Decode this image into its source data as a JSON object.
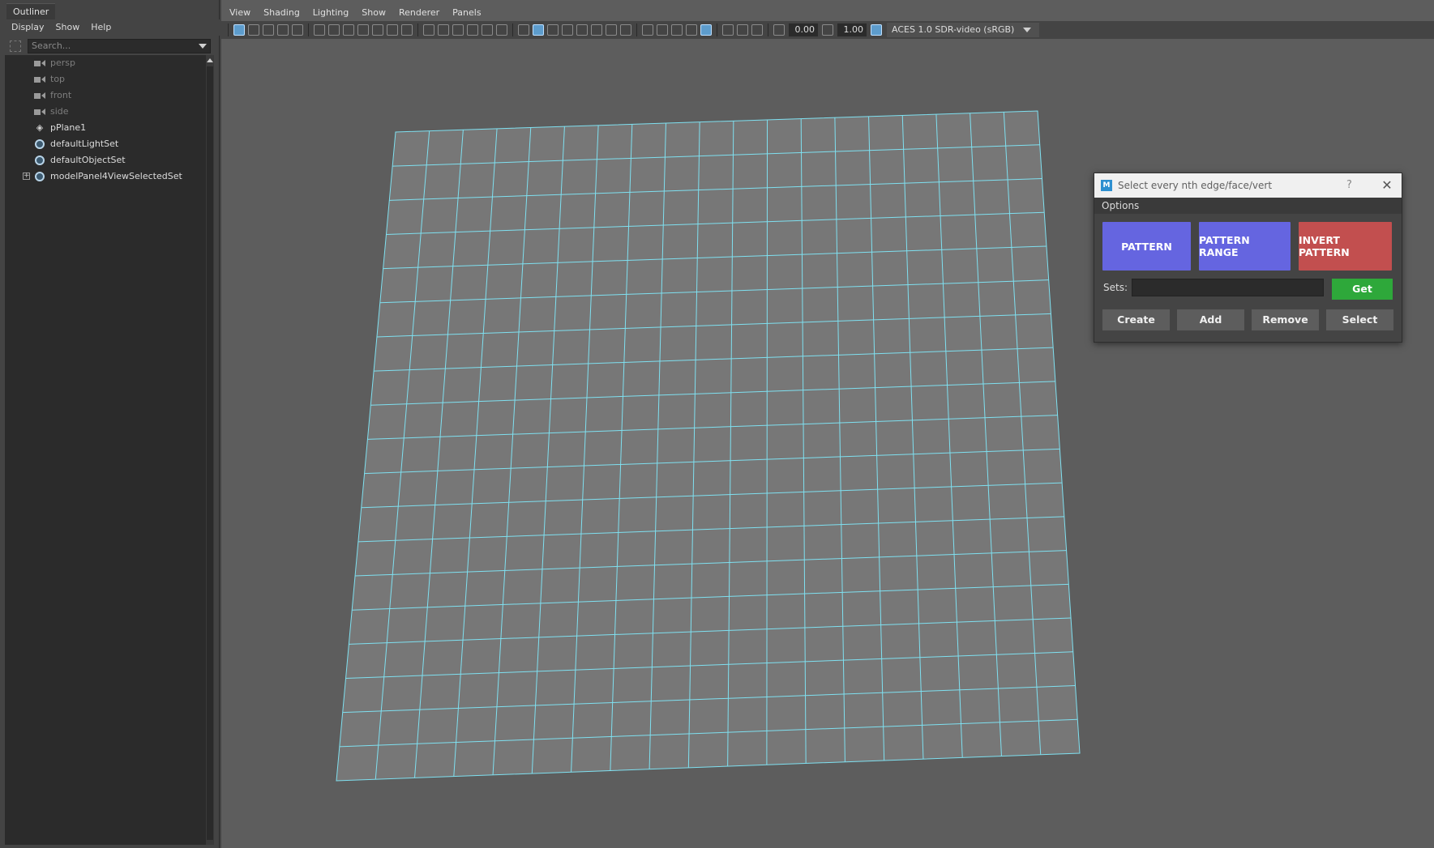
{
  "outliner": {
    "tab_label": "Outliner",
    "menu": [
      "Display",
      "Show",
      "Help"
    ],
    "search_placeholder": "Search...",
    "items": [
      {
        "label": "persp",
        "icon": "camera-icon",
        "dim": true
      },
      {
        "label": "top",
        "icon": "camera-icon",
        "dim": true
      },
      {
        "label": "front",
        "icon": "camera-icon",
        "dim": true
      },
      {
        "label": "side",
        "icon": "camera-icon",
        "dim": true
      },
      {
        "label": "pPlane1",
        "icon": "mesh-transform-icon",
        "dim": false
      },
      {
        "label": "defaultLightSet",
        "icon": "set-icon",
        "dim": false
      },
      {
        "label": "defaultObjectSet",
        "icon": "set-icon",
        "dim": false
      },
      {
        "label": "modelPanel4ViewSelectedSet",
        "icon": "set-icon",
        "dim": false,
        "expandable": true
      }
    ]
  },
  "viewport": {
    "menu": [
      "View",
      "Shading",
      "Lighting",
      "Show",
      "Renderer",
      "Panels"
    ],
    "exposure": "0.00",
    "gamma": "1.00",
    "color_space": "ACES 1.0 SDR-video (sRGB)",
    "wireframe_color": "#7fe0f0",
    "plane_color": "#777777",
    "grid_divisions": 19
  },
  "dialog": {
    "title": "Select every nth edge/face/vert",
    "app_icon": "M",
    "help_glyph": "?",
    "close_glyph": "✕",
    "section": "Options",
    "pattern_label": "PATTERN",
    "pattern_range_label": "PATTERN RANGE",
    "invert_pattern_label": "INVERT PATTERN",
    "sets_label": "Sets:",
    "get_label": "Get",
    "create_label": "Create",
    "add_label": "Add",
    "remove_label": "Remove",
    "select_label": "Select",
    "colors": {
      "pattern": "#6565e0",
      "invert": "#c24f4f",
      "get": "#2ea83a"
    }
  }
}
